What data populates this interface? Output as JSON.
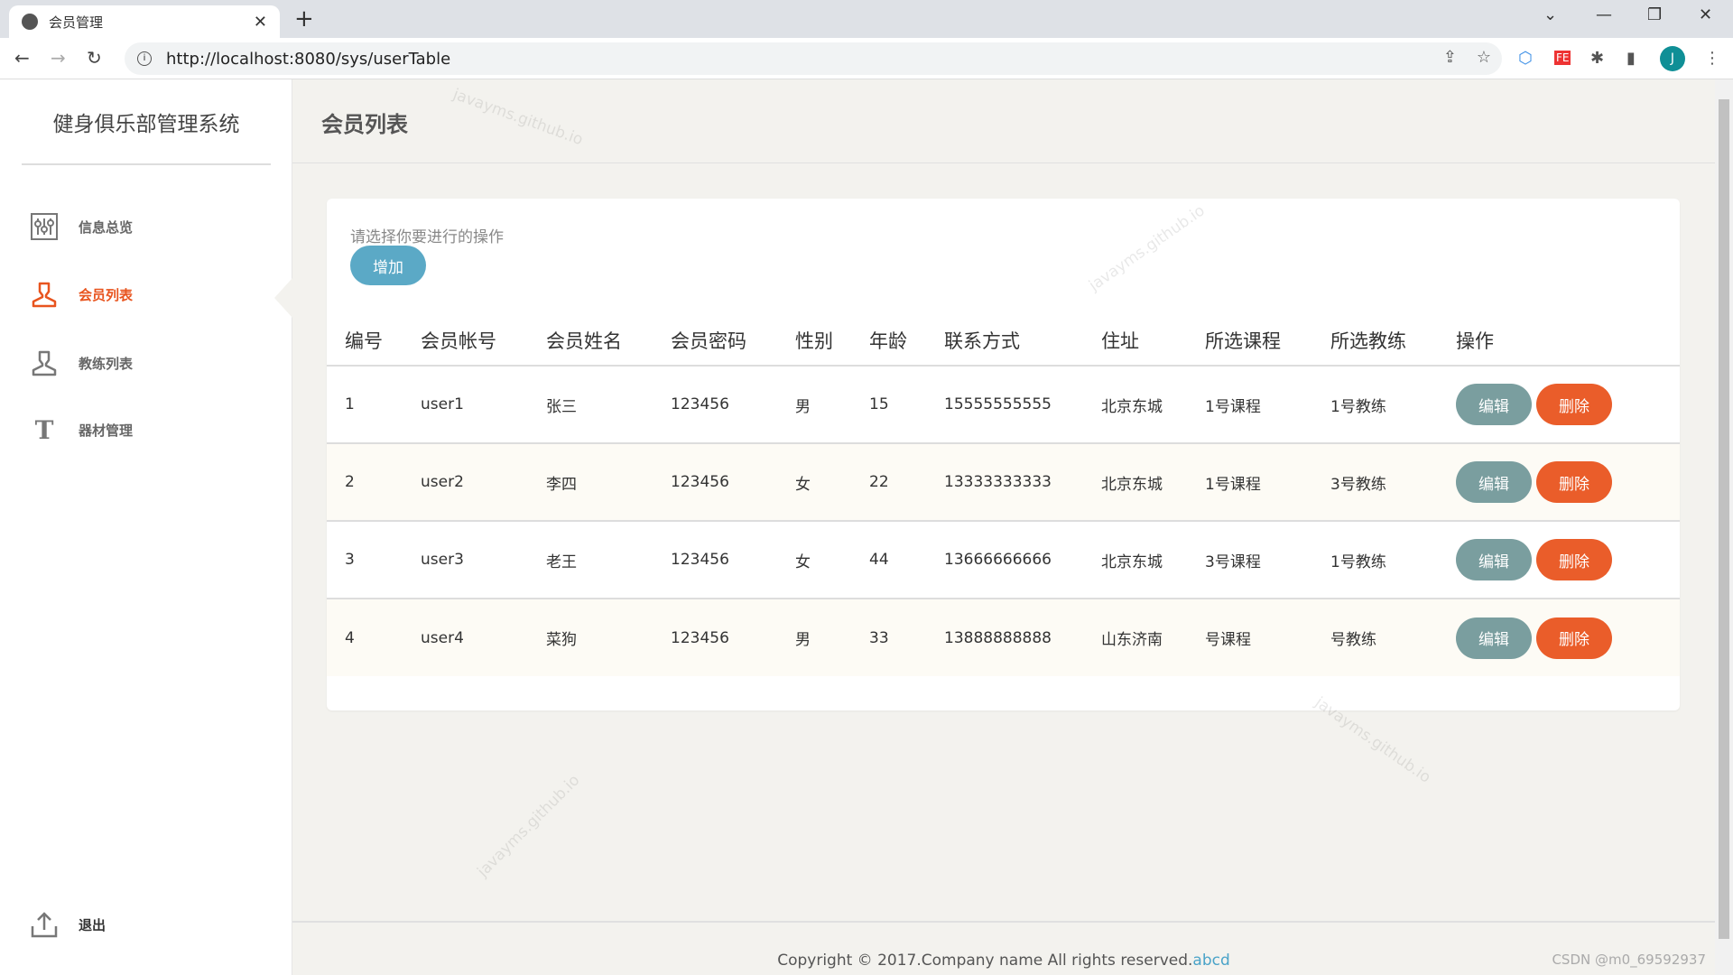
{
  "browser": {
    "tab_title": "会员管理",
    "url": "http://localhost:8080/sys/userTable",
    "avatar_letter": "J"
  },
  "sidebar": {
    "brand": "健身俱乐部管理系统",
    "items": [
      {
        "label": "信息总览",
        "icon": "sliders-icon"
      },
      {
        "label": "会员列表",
        "icon": "user-icon",
        "active": true
      },
      {
        "label": "教练列表",
        "icon": "user-icon"
      },
      {
        "label": "器材管理",
        "icon": "text-t-icon"
      }
    ],
    "logout": "退出"
  },
  "header": {
    "title": "会员列表"
  },
  "card": {
    "hint": "请选择你要进行的操作",
    "add_label": "增加"
  },
  "table": {
    "columns": [
      "编号",
      "会员帐号",
      "会员姓名",
      "会员密码",
      "性别",
      "年龄",
      "联系方式",
      "住址",
      "所选课程",
      "所选教练",
      "操作"
    ],
    "rows": [
      [
        "1",
        "user1",
        "张三",
        "123456",
        "男",
        "15",
        "15555555555",
        "北京东城",
        "1号课程",
        "1号教练"
      ],
      [
        "2",
        "user2",
        "李四",
        "123456",
        "女",
        "22",
        "13333333333",
        "北京东城",
        "1号课程",
        "3号教练"
      ],
      [
        "3",
        "user3",
        "老王",
        "123456",
        "女",
        "44",
        "13666666666",
        "北京东城",
        "3号课程",
        "1号教练"
      ],
      [
        "4",
        "user4",
        "菜狗",
        "123456",
        "男",
        "33",
        "13888888888",
        "山东济南",
        "号课程",
        "号教练"
      ]
    ],
    "edit_label": "编辑",
    "delete_label": "删除"
  },
  "footer": {
    "text": "Copyright © 2017.Company name All rights reserved.",
    "link": "abcd",
    "csdn": "CSDN @m0_69592937"
  },
  "watermark": "javayms.github.io",
  "colors": {
    "accent": "#e8541e",
    "edit": "#7a9e9f",
    "delete": "#ea5d2a",
    "add": "#5ba9c6"
  }
}
